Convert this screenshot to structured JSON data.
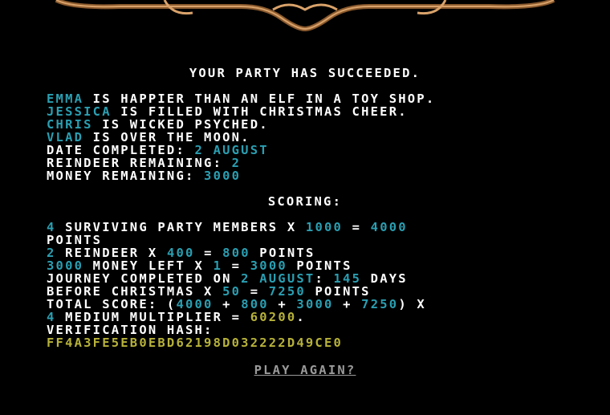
{
  "headline": "YOUR PARTY HAS SUCCEEDED.",
  "party": [
    {
      "name": "EMMA",
      "status": " IS HAPPIER THAN AN ELF IN A TOY SHOP."
    },
    {
      "name": "JESSICA",
      "status": " IS FILLED WITH CHRISTMAS CHEER."
    },
    {
      "name": "CHRIS",
      "status": " IS WICKED PSYCHED."
    },
    {
      "name": "VLAD",
      "status": " IS OVER THE MOON."
    }
  ],
  "summary": {
    "date_label": "DATE COMPLETED: ",
    "date_value": "2 AUGUST",
    "reindeer_label": "REINDEER REMAINING: ",
    "reindeer_value": "2",
    "money_label": "MONEY REMAINING: ",
    "money_value": "3000"
  },
  "scoring": {
    "title": "SCORING:",
    "members": {
      "count": "4",
      "t1": " SURVIVING PARTY MEMBERS X ",
      "mult": "1000",
      "t2": " = ",
      "result": "4000",
      "t3": "POINTS"
    },
    "reindeer": {
      "count": "2",
      "t1": " REINDEER X ",
      "mult": "400",
      "t2": " = ",
      "result": "800",
      "t3": " POINTS"
    },
    "money": {
      "amount": "3000",
      "t1": " MONEY LEFT X ",
      "mult": "1",
      "t2": " = ",
      "result": "3000",
      "t3": " POINTS"
    },
    "journey": {
      "t1": "JOURNEY COMPLETED ON ",
      "date": "2 AUGUST",
      "t2": ": ",
      "days": "145",
      "t3": " DAYS",
      "t4": "BEFORE CHRISTMAS X ",
      "mult": "50",
      "t5": " = ",
      "result": "7250",
      "t6": " POINTS"
    },
    "total": {
      "t1": "TOTAL SCORE: (",
      "a": "4000",
      "p1": " + ",
      "b": "800",
      "p2": " + ",
      "c": "3000",
      "p3": " + ",
      "d": "7250",
      "t2": ") X",
      "mult": "4",
      "t3": " MEDIUM MULTIPLIER = ",
      "final": "60200",
      "t4": "."
    },
    "hash_label": "VERIFICATION HASH:",
    "hash_value": "FF4A3FE5EB0EBD62198D032222D49CE0"
  },
  "play_again": "PLAY AGAIN?",
  "colors": {
    "highlight": "#2a9fb2",
    "hash": "#b7b23a",
    "frame": "#8a5a2e"
  }
}
